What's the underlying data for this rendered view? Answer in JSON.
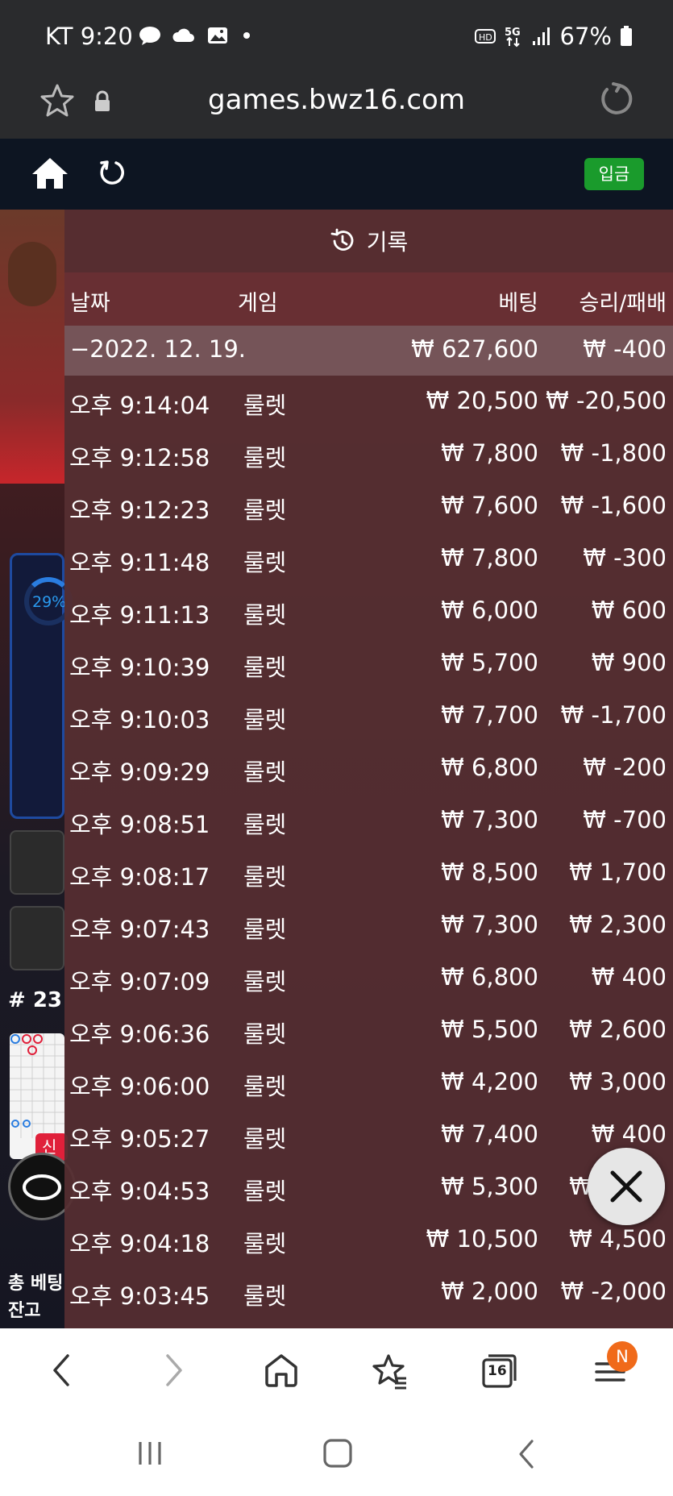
{
  "status_bar": {
    "carrier_time": "KT 9:20",
    "battery": "67%",
    "icons": [
      "talk-icon",
      "cloud-icon",
      "gallery-icon",
      "dot-icon",
      "hd-icon",
      "5g-icon",
      "signal-icon",
      "battery-icon"
    ]
  },
  "browser": {
    "url": "games.bwz16.com",
    "tab_count": "16",
    "notification_badge": "N"
  },
  "header": {
    "deposit_label": "입금"
  },
  "background_game": {
    "progress": "29%",
    "round_number": "# 23",
    "new_badge": "신",
    "total_bet_label": "총 베팅",
    "balance_label": "잔고"
  },
  "history": {
    "title": "기록",
    "columns": {
      "date": "날짜",
      "game": "게임",
      "bet": "베팅",
      "win_loss": "승리/패배"
    },
    "date_group": {
      "date": "−2022. 12. 19.",
      "total_bet": "₩ 627,600",
      "total_win_loss": "₩ -400"
    },
    "rows": [
      {
        "time": "오후 9:14:04",
        "game": "룰렛",
        "bet": "₩ 20,500",
        "win_loss": "₩ -20,500"
      },
      {
        "time": "오후 9:12:58",
        "game": "룰렛",
        "bet": "₩ 7,800",
        "win_loss": "₩ -1,800"
      },
      {
        "time": "오후 9:12:23",
        "game": "룰렛",
        "bet": "₩ 7,600",
        "win_loss": "₩ -1,600"
      },
      {
        "time": "오후 9:11:48",
        "game": "룰렛",
        "bet": "₩ 7,800",
        "win_loss": "₩ -300"
      },
      {
        "time": "오후 9:11:13",
        "game": "룰렛",
        "bet": "₩ 6,000",
        "win_loss": "₩ 600"
      },
      {
        "time": "오후 9:10:39",
        "game": "룰렛",
        "bet": "₩ 5,700",
        "win_loss": "₩ 900"
      },
      {
        "time": "오후 9:10:03",
        "game": "룰렛",
        "bet": "₩ 7,700",
        "win_loss": "₩ -1,700"
      },
      {
        "time": "오후 9:09:29",
        "game": "룰렛",
        "bet": "₩ 6,800",
        "win_loss": "₩ -200"
      },
      {
        "time": "오후 9:08:51",
        "game": "룰렛",
        "bet": "₩ 7,300",
        "win_loss": "₩ -700"
      },
      {
        "time": "오후 9:08:17",
        "game": "룰렛",
        "bet": "₩ 8,500",
        "win_loss": "₩ 1,700"
      },
      {
        "time": "오후 9:07:43",
        "game": "룰렛",
        "bet": "₩ 7,300",
        "win_loss": "₩ 2,300"
      },
      {
        "time": "오후 9:07:09",
        "game": "룰렛",
        "bet": "₩ 6,800",
        "win_loss": "₩ 400"
      },
      {
        "time": "오후 9:06:36",
        "game": "룰렛",
        "bet": "₩ 5,500",
        "win_loss": "₩ 2,600"
      },
      {
        "time": "오후 9:06:00",
        "game": "룰렛",
        "bet": "₩ 4,200",
        "win_loss": "₩ 3,000"
      },
      {
        "time": "오후 9:05:27",
        "game": "룰렛",
        "bet": "₩ 7,400",
        "win_loss": "₩ 400"
      },
      {
        "time": "오후 9:04:53",
        "game": "룰렛",
        "bet": "₩ 5,300",
        "win_loss": "₩ 1,700"
      },
      {
        "time": "오후 9:04:18",
        "game": "룰렛",
        "bet": "₩ 10,500",
        "win_loss": "₩ 4,500"
      },
      {
        "time": "오후 9:03:45",
        "game": "룰렛",
        "bet": "₩ 2,000",
        "win_loss": "₩ -2,000"
      }
    ]
  },
  "colors": {
    "deposit_green": "#1a9b2c",
    "panel_maroon": "#562e32",
    "notif_orange": "#f06a1a"
  }
}
